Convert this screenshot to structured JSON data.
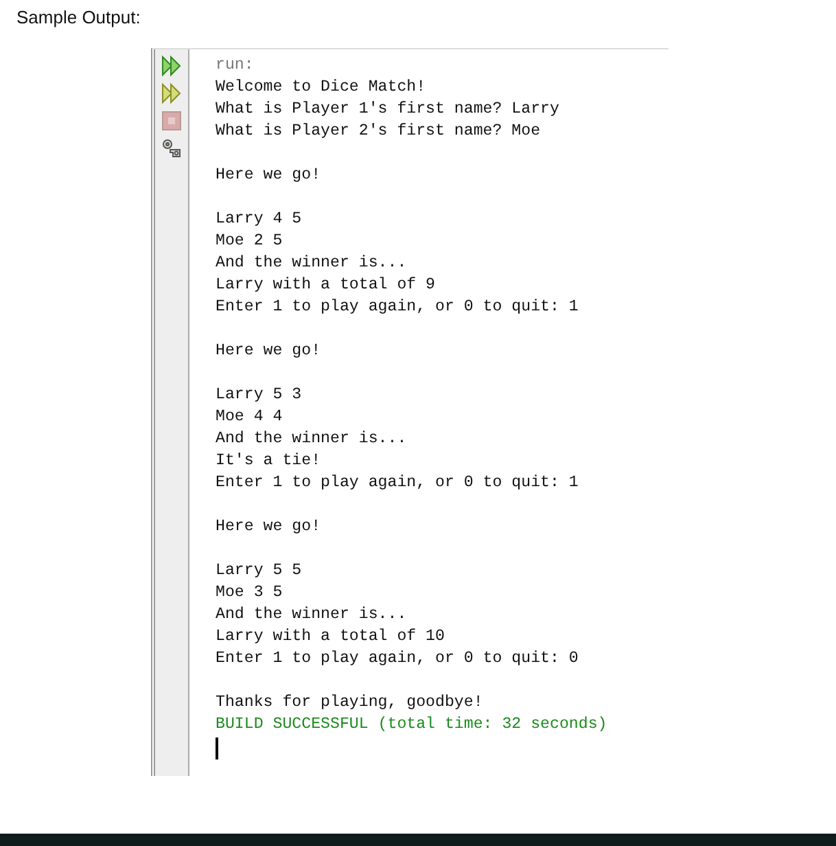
{
  "heading": "Sample Output:",
  "toolbar": [
    {
      "kind": "rerun",
      "disabled": false
    },
    {
      "kind": "rerun-params",
      "disabled": false
    },
    {
      "kind": "stop",
      "disabled": true
    },
    {
      "kind": "settings",
      "disabled": false
    }
  ],
  "console": {
    "caret": true,
    "lines": [
      {
        "kind": "system",
        "text": "run:"
      },
      {
        "kind": "output",
        "text": "Welcome to Dice Match!"
      },
      {
        "kind": "output",
        "text": "What is Player 1's first name? Larry"
      },
      {
        "kind": "output",
        "text": "What is Player 2's first name? Moe"
      },
      {
        "kind": "blank"
      },
      {
        "kind": "output",
        "text": "Here we go!"
      },
      {
        "kind": "blank"
      },
      {
        "kind": "output",
        "text": "Larry 4 5"
      },
      {
        "kind": "output",
        "text": "Moe 2 5"
      },
      {
        "kind": "output",
        "text": "And the winner is..."
      },
      {
        "kind": "output",
        "text": "Larry with a total of 9"
      },
      {
        "kind": "output",
        "text": "Enter 1 to play again, or 0 to quit: 1"
      },
      {
        "kind": "blank"
      },
      {
        "kind": "output",
        "text": "Here we go!"
      },
      {
        "kind": "blank"
      },
      {
        "kind": "output",
        "text": "Larry 5 3"
      },
      {
        "kind": "output",
        "text": "Moe 4 4"
      },
      {
        "kind": "output",
        "text": "And the winner is..."
      },
      {
        "kind": "output",
        "text": "It's a tie!"
      },
      {
        "kind": "output",
        "text": "Enter 1 to play again, or 0 to quit: 1"
      },
      {
        "kind": "blank"
      },
      {
        "kind": "output",
        "text": "Here we go!"
      },
      {
        "kind": "blank"
      },
      {
        "kind": "output",
        "text": "Larry 5 5"
      },
      {
        "kind": "output",
        "text": "Moe 3 5"
      },
      {
        "kind": "output",
        "text": "And the winner is..."
      },
      {
        "kind": "output",
        "text": "Larry with a total of 10"
      },
      {
        "kind": "output",
        "text": "Enter 1 to play again, or 0 to quit: 0"
      },
      {
        "kind": "blank"
      },
      {
        "kind": "output",
        "text": "Thanks for playing, goodbye!"
      },
      {
        "kind": "success",
        "text": "BUILD SUCCESSFUL (total time: 32 seconds)"
      }
    ]
  }
}
